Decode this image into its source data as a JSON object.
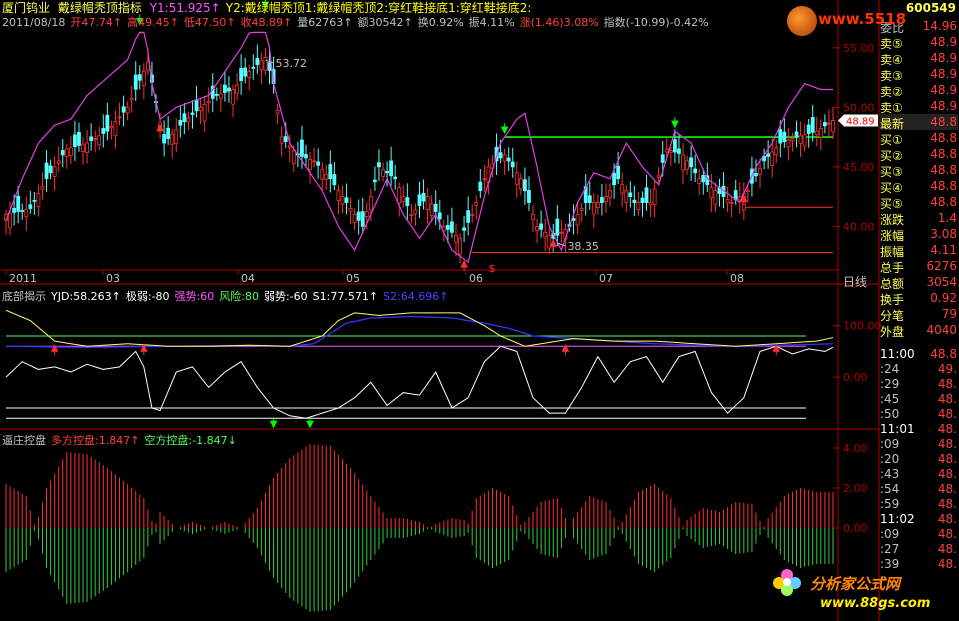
{
  "stock": {
    "name": "厦门钨业",
    "code": "600549"
  },
  "indicator_name": "戴绿帽秃顶指标",
  "top_params": [
    {
      "text": "Y1:51.925↑",
      "color": "#ff55ff"
    },
    {
      "text": "Y2:戴绿帽秃顶1:戴绿帽秃顶2:穿红鞋接底1:穿红鞋接底2:",
      "color": "#ffff00"
    }
  ],
  "info_line": [
    {
      "text": "2011/08/18",
      "color": "#c0c0c0"
    },
    {
      "text": "开47.74↑",
      "color": "#ff4040"
    },
    {
      "text": "高49.45↑",
      "color": "#ff4040"
    },
    {
      "text": "低47.50↑",
      "color": "#ff4040"
    },
    {
      "text": "收48.89↑",
      "color": "#ff4040"
    },
    {
      "text": "量62763↑",
      "color": "#c0c0c0"
    },
    {
      "text": "额30542↑",
      "color": "#c0c0c0"
    },
    {
      "text": "换0.92%",
      "color": "#c0c0c0"
    },
    {
      "text": "振4.11%",
      "color": "#c0c0c0"
    },
    {
      "text": "涨(1.46)3.08%",
      "color": "#ff4040"
    },
    {
      "text": "指数(-10.99)-0.42%",
      "color": "#c0c0c0"
    }
  ],
  "panel2_legend": [
    {
      "text": "底部揭示",
      "color": "#c0c0c0"
    },
    {
      "text": "YJD:58.263↑",
      "color": "#ffffff"
    },
    {
      "text": "极弱:-80",
      "color": "#ffffff"
    },
    {
      "text": "强势:60",
      "color": "#ff55ff"
    },
    {
      "text": "风险:80",
      "color": "#55ff55"
    },
    {
      "text": "弱势:-60",
      "color": "#ffffff"
    },
    {
      "text": "S1:77.571↑",
      "color": "#ffffff"
    },
    {
      "text": "S2:64.696↑",
      "color": "#4444ff"
    }
  ],
  "panel3_legend": [
    {
      "text": "逼庄控盘",
      "color": "#c0c0c0"
    },
    {
      "text": "多方控盘:1.847↑",
      "color": "#ff4040"
    },
    {
      "text": "空方控盘:-1.847↓",
      "color": "#55ff55"
    }
  ],
  "month_labels": [
    "2011",
    "03",
    "04",
    "05",
    "06",
    "07",
    "08"
  ],
  "period_label": "日线",
  "right_panel": {
    "weibi": {
      "label": "委比",
      "value": "14.96"
    },
    "sells": [
      {
        "label": "卖⑤",
        "value": "48.9"
      },
      {
        "label": "卖④",
        "value": "48.9"
      },
      {
        "label": "卖③",
        "value": "48.9"
      },
      {
        "label": "卖②",
        "value": "48.9"
      },
      {
        "label": "卖①",
        "value": "48.9"
      }
    ],
    "latest": {
      "label": "最新",
      "value": "48.8"
    },
    "buys": [
      {
        "label": "买①",
        "value": "48.8"
      },
      {
        "label": "买②",
        "value": "48.8"
      },
      {
        "label": "买③",
        "value": "48.8"
      },
      {
        "label": "买④",
        "value": "48.8"
      },
      {
        "label": "买⑤",
        "value": "48.8"
      }
    ],
    "stats": [
      {
        "label": "涨跌",
        "value": "1.4"
      },
      {
        "label": "涨幅",
        "value": "3.08"
      },
      {
        "label": "振幅",
        "value": "4.11"
      },
      {
        "label": "总手",
        "value": "6276"
      },
      {
        "label": "总额",
        "value": "3054"
      },
      {
        "label": "换手",
        "value": "0.92"
      },
      {
        "label": "分笔",
        "value": "79"
      },
      {
        "label": "外盘",
        "value": "4040"
      }
    ],
    "ticks": [
      {
        "time": "11:00",
        "value": "48.8"
      },
      {
        "time": ":24",
        "value": "49."
      },
      {
        "time": ":29",
        "value": "48."
      },
      {
        "time": ":45",
        "value": "48."
      },
      {
        "time": ":50",
        "value": "48."
      },
      {
        "time": "11:01",
        "value": "48."
      },
      {
        "time": ":09",
        "value": "48."
      },
      {
        "time": ":20",
        "value": "48."
      },
      {
        "time": ":43",
        "value": "48."
      },
      {
        "time": ":54",
        "value": "48."
      },
      {
        "time": ":59",
        "value": "48."
      },
      {
        "time": "11:02",
        "value": "48."
      },
      {
        "time": ":09",
        "value": "48."
      },
      {
        "time": ":27",
        "value": "48."
      },
      {
        "time": ":39",
        "value": "48."
      }
    ]
  },
  "watermarks": {
    "top": "www.5518",
    "brand": "分析家公式网",
    "url": "www.88gs.com"
  },
  "chart_data": [
    {
      "type": "candlestick",
      "title": "戴绿帽秃顶指标",
      "ylim": [
        36.5,
        56.5
      ],
      "yticks": [
        40.0,
        45.0,
        50.0,
        55.0
      ],
      "current_price_tag": "48.89",
      "annotations": [
        {
          "text": "53.72",
          "x": 66,
          "y": 53.72
        },
        {
          "text": "38.35",
          "x": 138,
          "y": 38.35
        }
      ],
      "hlines": [
        {
          "y": 47.5,
          "x_from": 123,
          "color": "#00ff00",
          "width": 1.6
        },
        {
          "y": 41.6,
          "x_from": 182,
          "color": "#ff3030",
          "width": 1
        },
        {
          "y": 37.8,
          "x_from": 115,
          "color": "#ff3030",
          "width": 1
        }
      ],
      "x_count": 205,
      "closes_anchor": [
        [
          0,
          41
        ],
        [
          6,
          41.5
        ],
        [
          10,
          44
        ],
        [
          15,
          46.5
        ],
        [
          20,
          47
        ],
        [
          25,
          48
        ],
        [
          30,
          50
        ],
        [
          35,
          53.8
        ],
        [
          39,
          47
        ],
        [
          43,
          48.5
        ],
        [
          48,
          50
        ],
        [
          52,
          51
        ],
        [
          56,
          51.5
        ],
        [
          60,
          53
        ],
        [
          64,
          54.2
        ],
        [
          66,
          52
        ],
        [
          68,
          47.5
        ],
        [
          72,
          46
        ],
        [
          76,
          45.5
        ],
        [
          80,
          44
        ],
        [
          84,
          42
        ],
        [
          88,
          40
        ],
        [
          92,
          45
        ],
        [
          96,
          44
        ],
        [
          100,
          41
        ],
        [
          104,
          42.5
        ],
        [
          108,
          40
        ],
        [
          112,
          39
        ],
        [
          115,
          41
        ],
        [
          119,
          45
        ],
        [
          123,
          46
        ],
        [
          127,
          44
        ],
        [
          131,
          40
        ],
        [
          135,
          39
        ],
        [
          139,
          40
        ],
        [
          143,
          42
        ],
        [
          147,
          42
        ],
        [
          151,
          44
        ],
        [
          155,
          42
        ],
        [
          159,
          42
        ],
        [
          163,
          46.5
        ],
        [
          167,
          46
        ],
        [
          171,
          44
        ],
        [
          175,
          43
        ],
        [
          179,
          42
        ],
        [
          183,
          43
        ],
        [
          187,
          45.5
        ],
        [
          191,
          47
        ],
        [
          195,
          47.5
        ],
        [
          200,
          48
        ],
        [
          204,
          48.89
        ]
      ],
      "y1_anchor": [
        [
          0,
          40.5
        ],
        [
          4,
          44
        ],
        [
          8,
          47
        ],
        [
          12,
          48.5
        ],
        [
          16,
          49
        ],
        [
          20,
          51
        ],
        [
          25,
          52.5
        ],
        [
          30,
          54
        ],
        [
          34,
          57.5
        ],
        [
          36,
          52
        ],
        [
          38,
          49
        ],
        [
          42,
          50
        ],
        [
          46,
          50.5
        ],
        [
          50,
          51
        ],
        [
          54,
          53
        ],
        [
          58,
          55
        ],
        [
          62,
          57.5
        ],
        [
          64,
          58
        ],
        [
          66,
          52
        ],
        [
          70,
          47
        ],
        [
          74,
          45
        ],
        [
          78,
          43
        ],
        [
          82,
          40
        ],
        [
          86,
          38
        ],
        [
          90,
          41
        ],
        [
          94,
          44
        ],
        [
          98,
          41
        ],
        [
          102,
          39
        ],
        [
          106,
          41
        ],
        [
          110,
          38
        ],
        [
          114,
          37
        ],
        [
          118,
          42.5
        ],
        [
          122,
          47
        ],
        [
          126,
          49
        ],
        [
          128,
          49.5
        ],
        [
          131,
          45
        ],
        [
          134,
          40
        ],
        [
          137,
          38
        ],
        [
          141,
          42
        ],
        [
          145,
          44.5
        ],
        [
          149,
          44
        ],
        [
          153,
          47
        ],
        [
          157,
          45
        ],
        [
          161,
          43.5
        ],
        [
          165,
          48
        ],
        [
          169,
          47
        ],
        [
          173,
          44
        ],
        [
          177,
          43
        ],
        [
          181,
          42
        ],
        [
          185,
          45
        ],
        [
          189,
          47
        ],
        [
          193,
          50
        ],
        [
          197,
          52
        ],
        [
          201,
          51.5
        ]
      ],
      "buy_marks_x": [
        38,
        113,
        135,
        182
      ],
      "sell_marks_x": [
        33,
        64,
        123,
        165
      ],
      "s_mark_x": 120
    },
    {
      "type": "line",
      "title": "底部揭示",
      "ylim": [
        -95,
        150
      ],
      "yticks": [
        0.0,
        100.0
      ],
      "hlines": [
        {
          "y": 80,
          "color": "#55ff55"
        },
        {
          "y": 60,
          "color": "#ff55ff"
        },
        {
          "y": -60,
          "color": "#ffffff"
        },
        {
          "y": -80,
          "color": "#ffffff"
        }
      ],
      "yjd_anchor": [
        [
          0,
          0
        ],
        [
          4,
          30
        ],
        [
          8,
          15
        ],
        [
          12,
          20
        ],
        [
          16,
          10
        ],
        [
          20,
          25
        ],
        [
          24,
          15
        ],
        [
          28,
          20
        ],
        [
          32,
          50
        ],
        [
          34,
          20
        ],
        [
          36,
          -60
        ],
        [
          38,
          -65
        ],
        [
          42,
          10
        ],
        [
          46,
          20
        ],
        [
          50,
          -20
        ],
        [
          54,
          10
        ],
        [
          58,
          30
        ],
        [
          62,
          -20
        ],
        [
          66,
          -60
        ],
        [
          70,
          -75
        ],
        [
          74,
          -80
        ],
        [
          78,
          -70
        ],
        [
          82,
          -60
        ],
        [
          86,
          -40
        ],
        [
          90,
          -10
        ],
        [
          94,
          -55
        ],
        [
          98,
          -30
        ],
        [
          102,
          -35
        ],
        [
          106,
          10
        ],
        [
          110,
          -60
        ],
        [
          114,
          -40
        ],
        [
          118,
          30
        ],
        [
          122,
          60
        ],
        [
          126,
          50
        ],
        [
          130,
          -40
        ],
        [
          134,
          -70
        ],
        [
          138,
          -70
        ],
        [
          142,
          -20
        ],
        [
          146,
          40
        ],
        [
          150,
          -10
        ],
        [
          154,
          30
        ],
        [
          158,
          40
        ],
        [
          162,
          -10
        ],
        [
          166,
          40
        ],
        [
          170,
          50
        ],
        [
          174,
          -30
        ],
        [
          178,
          -70
        ],
        [
          182,
          -40
        ],
        [
          186,
          50
        ],
        [
          190,
          60
        ],
        [
          194,
          45
        ],
        [
          198,
          55
        ],
        [
          202,
          50
        ],
        [
          204,
          58
        ]
      ],
      "s1_anchor": [
        [
          0,
          130
        ],
        [
          6,
          110
        ],
        [
          12,
          70
        ],
        [
          20,
          60
        ],
        [
          30,
          65
        ],
        [
          40,
          60
        ],
        [
          50,
          60
        ],
        [
          60,
          62
        ],
        [
          70,
          60
        ],
        [
          78,
          80
        ],
        [
          82,
          110
        ],
        [
          86,
          125
        ],
        [
          92,
          120
        ],
        [
          100,
          125
        ],
        [
          108,
          125
        ],
        [
          112,
          125
        ],
        [
          118,
          100
        ],
        [
          122,
          80
        ],
        [
          128,
          60
        ],
        [
          140,
          75
        ],
        [
          150,
          70
        ],
        [
          160,
          70
        ],
        [
          170,
          65
        ],
        [
          180,
          60
        ],
        [
          190,
          65
        ],
        [
          200,
          70
        ],
        [
          204,
          77
        ]
      ],
      "s2_anchor": [
        [
          0,
          60
        ],
        [
          20,
          58
        ],
        [
          40,
          60
        ],
        [
          60,
          62
        ],
        [
          70,
          60
        ],
        [
          76,
          65
        ],
        [
          80,
          85
        ],
        [
          84,
          105
        ],
        [
          90,
          115
        ],
        [
          100,
          118
        ],
        [
          110,
          115
        ],
        [
          118,
          105
        ],
        [
          124,
          95
        ],
        [
          130,
          80
        ],
        [
          140,
          75
        ],
        [
          150,
          70
        ],
        [
          160,
          65
        ],
        [
          170,
          62
        ],
        [
          180,
          60
        ],
        [
          190,
          62
        ],
        [
          200,
          64
        ],
        [
          204,
          65
        ]
      ],
      "buy_marks_x": [
        66,
        75
      ],
      "sell_marks_x": [
        12,
        34,
        138,
        190
      ]
    },
    {
      "type": "histogram",
      "title": "逼庄控盘",
      "ylim": [
        -4.5,
        4.5
      ],
      "yticks": [
        0.0,
        2.0,
        4.0
      ],
      "series": [
        {
          "name": "多方控盘",
          "color": "#ff3030"
        },
        {
          "name": "空方控盘",
          "color": "#33cc33"
        }
      ],
      "values_anchor": [
        [
          0,
          -2.2
        ],
        [
          5,
          -1.6
        ],
        [
          10,
          2
        ],
        [
          15,
          3.8
        ],
        [
          20,
          3.7
        ],
        [
          25,
          3
        ],
        [
          30,
          2.2
        ],
        [
          34,
          1.5
        ],
        [
          38,
          -0.8
        ],
        [
          42,
          0
        ],
        [
          46,
          0.3
        ],
        [
          50,
          0
        ],
        [
          54,
          -0.3
        ],
        [
          58,
          0
        ],
        [
          62,
          -1
        ],
        [
          66,
          -2.5
        ],
        [
          70,
          -3.5
        ],
        [
          75,
          -4.2
        ],
        [
          80,
          -4.1
        ],
        [
          85,
          -3
        ],
        [
          90,
          -1.6
        ],
        [
          94,
          -0.5
        ],
        [
          98,
          -0.5
        ],
        [
          102,
          -0.3
        ],
        [
          106,
          0.2
        ],
        [
          110,
          0.5
        ],
        [
          113,
          0.4
        ],
        [
          116,
          -1.5
        ],
        [
          120,
          -2
        ],
        [
          124,
          -1.6
        ],
        [
          128,
          0.3
        ],
        [
          132,
          1.3
        ],
        [
          136,
          1.5
        ],
        [
          140,
          -0.5
        ],
        [
          144,
          -1.6
        ],
        [
          148,
          -1.3
        ],
        [
          152,
          0.3
        ],
        [
          156,
          1.8
        ],
        [
          160,
          2.2
        ],
        [
          164,
          1.5
        ],
        [
          168,
          -0.4
        ],
        [
          172,
          -1
        ],
        [
          176,
          -0.8
        ],
        [
          180,
          -1.3
        ],
        [
          184,
          -1.2
        ],
        [
          188,
          0.5
        ],
        [
          192,
          1.6
        ],
        [
          196,
          2
        ],
        [
          200,
          1.8
        ],
        [
          204,
          1.8
        ]
      ]
    }
  ]
}
